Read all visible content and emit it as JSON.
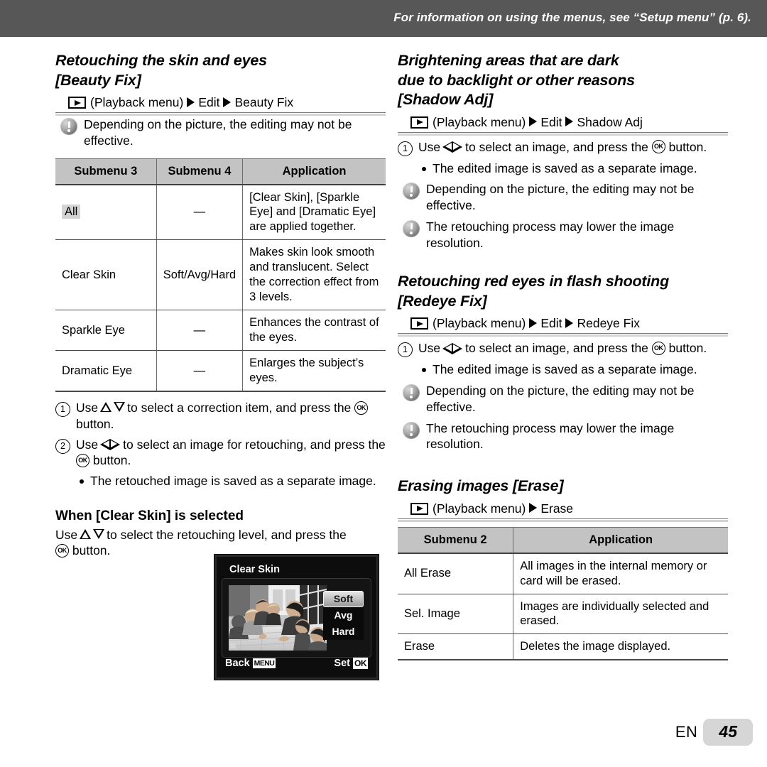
{
  "header": {
    "notice": "For information on using the menus, see “Setup menu” (p. 6)."
  },
  "left_column": {
    "section_title_line1": "Retouching the skin and eyes",
    "section_title_line2": "[Beauty Fix]",
    "path": {
      "playback_icon": "playback-icon",
      "menu_label": "(Playback menu)",
      "step1": "Edit",
      "step2": "Beauty Fix"
    },
    "note": "Depending on the picture, the editing may not be effective.",
    "table": {
      "headers": [
        "Submenu 3",
        "Submenu 4",
        "Application"
      ],
      "rows": [
        {
          "submenu3": "All",
          "submenu3_highlight": true,
          "submenu4": "—",
          "application": "[Clear Skin], [Sparkle Eye] and [Dramatic Eye] are applied together."
        },
        {
          "submenu3": "Clear Skin",
          "submenu3_highlight": false,
          "submenu4": "Soft/Avg/Hard",
          "application": "Makes skin look smooth and translucent. Select the correction effect from 3 levels."
        },
        {
          "submenu3": "Sparkle Eye",
          "submenu3_highlight": false,
          "submenu4": "—",
          "application": "Enhances the contrast of the eyes."
        },
        {
          "submenu3": "Dramatic Eye",
          "submenu3_highlight": false,
          "submenu4": "—",
          "application": "Enlarges the subject’s eyes."
        }
      ]
    },
    "steps": [
      {
        "number": "1",
        "pre": "Use",
        "keys": "up-down",
        "post": "to select a correction item, and press the",
        "tail": "button."
      },
      {
        "number": "2",
        "pre": "Use",
        "keys": "left-right",
        "post": "to select an image for retouching, and press the",
        "tail": "button."
      }
    ],
    "step_bullet": "The retouched image is saved as a separate image.",
    "subheading": "When [Clear Skin] is selected",
    "sub_instruction_pre": "Use",
    "sub_instruction_post": "to select the retouching level, and press the",
    "sub_instruction_tail": "button."
  },
  "lcd": {
    "title": "Clear Skin",
    "options": [
      {
        "label": "Soft",
        "selected": true
      },
      {
        "label": "Avg",
        "selected": false
      },
      {
        "label": "Hard",
        "selected": false
      }
    ],
    "footer_left_label": "Back",
    "footer_left_badge": "MENU",
    "footer_right_label": "Set",
    "footer_right_badge": "OK"
  },
  "right_column": {
    "shadow_adj": {
      "title_line1": "Brightening areas that are dark",
      "title_line2": "due to backlight or other reasons",
      "title_line3": "[Shadow Adj]",
      "path": {
        "menu_label": "(Playback menu)",
        "step1": "Edit",
        "step2": "Shadow Adj"
      },
      "step_number": "1",
      "step_pre": "Use",
      "step_post": "to select an image, and press the",
      "step_tail": "button.",
      "bullet": "The edited image is saved as a separate image.",
      "notes": [
        "Depending on the picture, the editing may not be effective.",
        "The retouching process may lower the image resolution."
      ]
    },
    "redeye_fix": {
      "title_line1": "Retouching red eyes in flash shooting",
      "title_line2": "[Redeye Fix]",
      "path": {
        "menu_label": "(Playback menu)",
        "step1": "Edit",
        "step2": "Redeye Fix"
      },
      "step_number": "1",
      "step_pre": "Use",
      "step_post": "to select an image, and press the",
      "step_tail": "button.",
      "bullet": "The edited image is saved as a separate image.",
      "notes": [
        "Depending on the picture, the editing may not be effective.",
        "The retouching process may lower the image resolution."
      ]
    },
    "erase": {
      "title": "Erasing images [Erase]",
      "path": {
        "menu_label": "(Playback menu)",
        "step1": "Erase"
      },
      "table": {
        "headers": [
          "Submenu 2",
          "Application"
        ],
        "rows": [
          {
            "submenu2": "All Erase",
            "application": "All images in the internal memory or card will be erased."
          },
          {
            "submenu2": "Sel. Image",
            "application": "Images are individually selected and erased."
          },
          {
            "submenu2": "Erase",
            "application": "Deletes the image displayed."
          }
        ]
      }
    }
  },
  "footer": {
    "language": "EN",
    "page_number": "45"
  },
  "colors": {
    "header_bar": "#575757",
    "table_header": "#c3c3c3",
    "cell_highlight": "#d3d3d3",
    "page_badge": "#d6d6d6"
  }
}
